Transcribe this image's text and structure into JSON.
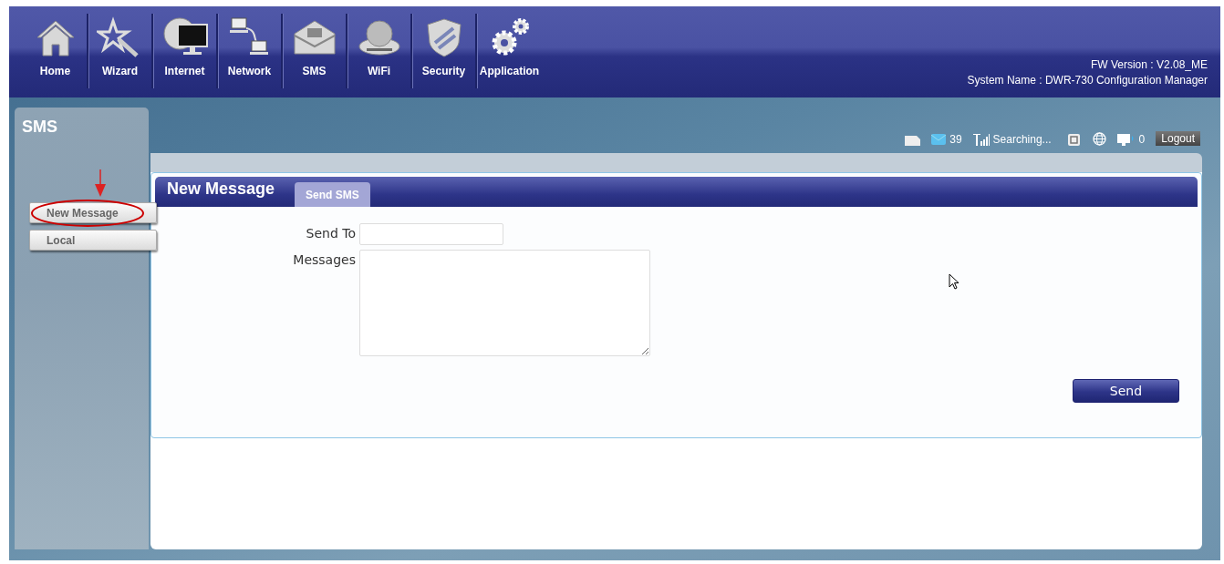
{
  "nav": [
    {
      "label": "Home"
    },
    {
      "label": "Wizard"
    },
    {
      "label": "Internet"
    },
    {
      "label": "Network"
    },
    {
      "label": "SMS"
    },
    {
      "label": "WiFi"
    },
    {
      "label": "Security"
    },
    {
      "label": "Application"
    }
  ],
  "header_info": [
    "FW Version : V2.08_ME",
    "System Name : DWR-730 Configuration Manager"
  ],
  "sidebar": {
    "title": "SMS",
    "items": [
      {
        "label": "New Message",
        "annotated": true
      },
      {
        "label": "Local",
        "annotated": false
      }
    ]
  },
  "status_bar": {
    "sms_count": "39",
    "signal": "Searching...",
    "clients": "0",
    "logout": "Logout"
  },
  "panel": {
    "title": "New Message",
    "tabs": [
      {
        "label": "Send SMS"
      }
    ],
    "fields": [
      {
        "kind": "input",
        "label": "Send To"
      },
      {
        "kind": "textarea",
        "label": "Messages"
      }
    ],
    "button": "Send"
  }
}
